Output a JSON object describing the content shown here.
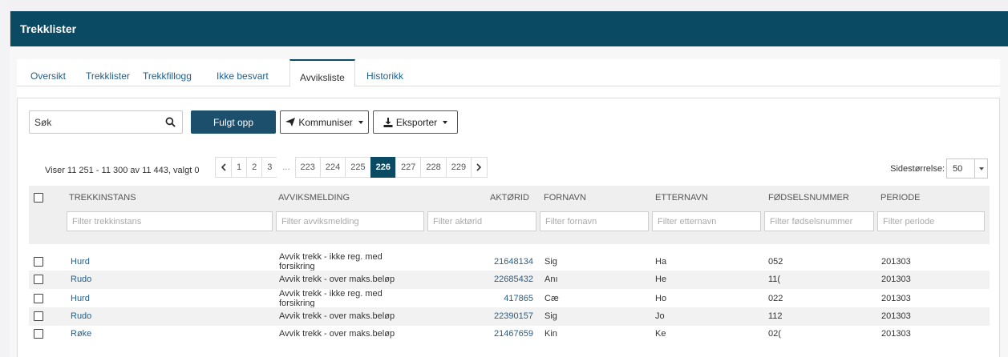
{
  "header": {
    "title": "Trekklister"
  },
  "tabs": [
    {
      "label": "Oversikt"
    },
    {
      "label": "Trekklister"
    },
    {
      "label": "Trekkfillogg"
    },
    {
      "label": "Ikke besvart"
    },
    {
      "label": "Avviksliste"
    },
    {
      "label": "Historikk"
    }
  ],
  "active_tab": "Avviksliste",
  "toolbar": {
    "search_value": "Søk",
    "followed_up_label": "Fulgt opp",
    "communicate_label": "Kommuniser",
    "export_label": "Eksporter"
  },
  "pager": {
    "info": "Viser 11 251 - 11 300 av 11 443, valgt 0",
    "pages": [
      "1",
      "2",
      "3",
      "...",
      "223",
      "224",
      "225",
      "226",
      "227",
      "228",
      "229"
    ],
    "current": "226",
    "page_size_label": "Sidestørrelse:",
    "page_size": "50"
  },
  "table": {
    "columns": [
      "TREKKINSTANS",
      "AVVIKSMELDING",
      "AKTØRID",
      "FORNAVN",
      "ETTERNAVN",
      "FØDSELSNUMMER",
      "PERIODE"
    ],
    "filters": [
      "Filter trekkinstans",
      "Filter avviksmelding",
      "Filter aktørid",
      "Filter fornavn",
      "Filter etternavn",
      "Filter fødselsnummer",
      "Filter periode"
    ],
    "rows": [
      {
        "instans": "Hurd",
        "melding_1": "Avvik trekk - ikke reg. med",
        "melding_2": "forsikring",
        "aktorid": "21648134",
        "fornavn": "Sig",
        "etternavn": "Ha",
        "fnr": "052",
        "periode": "201303"
      },
      {
        "instans": "Rudo",
        "melding_1": "Avvik trekk - over maks.beløp",
        "melding_2": "",
        "aktorid": "22685432",
        "fornavn": "Anı",
        "etternavn": "He",
        "fnr": "11(",
        "periode": "201303"
      },
      {
        "instans": "Hurd",
        "melding_1": "Avvik trekk - ikke reg. med",
        "melding_2": "forsikring",
        "aktorid": "417865",
        "fornavn": "Cæ",
        "etternavn": "Ho",
        "fnr": "022",
        "periode": "201303"
      },
      {
        "instans": "Rudo",
        "melding_1": "Avvik trekk - over maks.beløp",
        "melding_2": "",
        "aktorid": "22390157",
        "fornavn": "Sig",
        "etternavn": "Jo",
        "fnr": "112",
        "periode": "201303"
      },
      {
        "instans": "Røke",
        "melding_1": "Avvik trekk - over maks.beløp",
        "melding_2": "",
        "aktorid": "21467659",
        "fornavn": "Kin",
        "etternavn": "Ke",
        "fnr": "02(",
        "periode": "201303"
      }
    ]
  },
  "colors": {
    "header": "#0b4a63",
    "primary_button": "#1b4f6b",
    "link": "#1f5f8b"
  },
  "icons": {
    "search": "search-icon",
    "communicate": "paper-plane-icon",
    "export": "download-icon",
    "prev": "chevron-left-icon",
    "next": "chevron-right-icon"
  }
}
